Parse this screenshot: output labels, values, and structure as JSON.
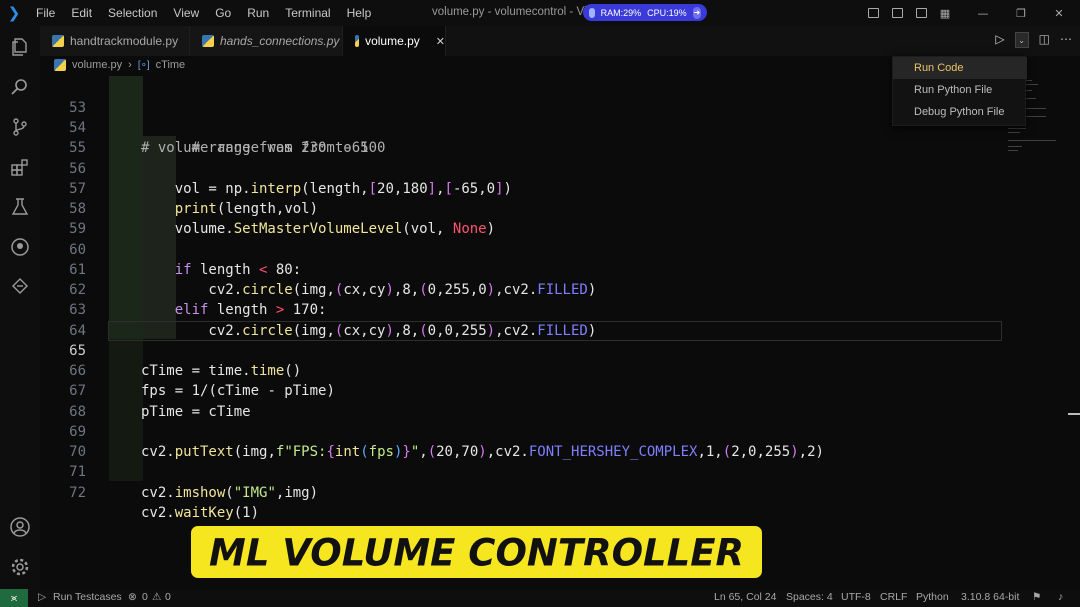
{
  "titlebar": {
    "menu": [
      "File",
      "Edit",
      "Selection",
      "View",
      "Go",
      "Run",
      "Terminal",
      "Help"
    ],
    "window_title": "volume.py - volumecontrol - Visu",
    "ram": "RAM:29%",
    "cpu": "CPU:19%"
  },
  "tabs": [
    {
      "label": "handtrackmodule.py",
      "italic": false
    },
    {
      "label": "hands_connections.py",
      "italic": true
    },
    {
      "label": "volume.py",
      "active": true
    }
  ],
  "breadcrumb": {
    "file": "volume.py",
    "symbol": "cTime"
  },
  "run_menu": {
    "items": [
      "Run Code",
      "Run Python File",
      "Debug Python File"
    ],
    "highlighted": 0
  },
  "editor": {
    "current_line": 65,
    "lines": [
      {
        "n": "53",
        "t": "# range from 230 to 10"
      },
      {
        "n": "54",
        "t": "# volume range was from -65 0"
      },
      {
        "n": "55",
        "t": ""
      },
      {
        "n": "56",
        "t": "    vol = np.interp(length,[20,180],[-65,0])"
      },
      {
        "n": "57",
        "t": "    print(length,vol)"
      },
      {
        "n": "58",
        "t": "    volume.SetMasterVolumeLevel(vol, None)"
      },
      {
        "n": "59",
        "t": ""
      },
      {
        "n": "60",
        "t": "    if length < 80:"
      },
      {
        "n": "61",
        "t": "        cv2.circle(img,(cx,cy),8,(0,255,0),cv2.FILLED)"
      },
      {
        "n": "62",
        "t": "    elif length > 170:"
      },
      {
        "n": "63",
        "t": "        cv2.circle(img,(cx,cy),8,(0,0,255),cv2.FILLED)"
      },
      {
        "n": "64",
        "t": ""
      },
      {
        "n": "65",
        "t": "cTime = time.time()"
      },
      {
        "n": "66",
        "t": "fps = 1/(cTime - pTime)"
      },
      {
        "n": "67",
        "t": "pTime = cTime"
      },
      {
        "n": "68",
        "t": ""
      },
      {
        "n": "69",
        "t": "cv2.putText(img,f\"FPS:{int(fps)}\",(20,70),cv2.FONT_HERSHEY_COMPLEX,1,(2,0,255),2)"
      },
      {
        "n": "70",
        "t": ""
      },
      {
        "n": "71",
        "t": "cv2.imshow(\"IMG\",img)"
      },
      {
        "n": "72",
        "t": "cv2.waitKey(1)"
      }
    ]
  },
  "banner": {
    "text": "ML VOLUME CONTROLLER",
    "color": "#f6e620"
  },
  "statusbar": {
    "run_testcases": "Run Testcases",
    "errors": "0",
    "warnings": "0",
    "position": "Ln 65, Col 24",
    "spaces": "Spaces: 4",
    "encoding": "UTF-8",
    "eol": "CRLF",
    "language": "Python",
    "interpreter": "3.10.8 64-bit"
  },
  "colors": {
    "accent": "#3a3ad8",
    "keyword": "#c792ea",
    "function": "#f1e59a",
    "string": "#c3e88d",
    "constant": "#7f7fff"
  }
}
